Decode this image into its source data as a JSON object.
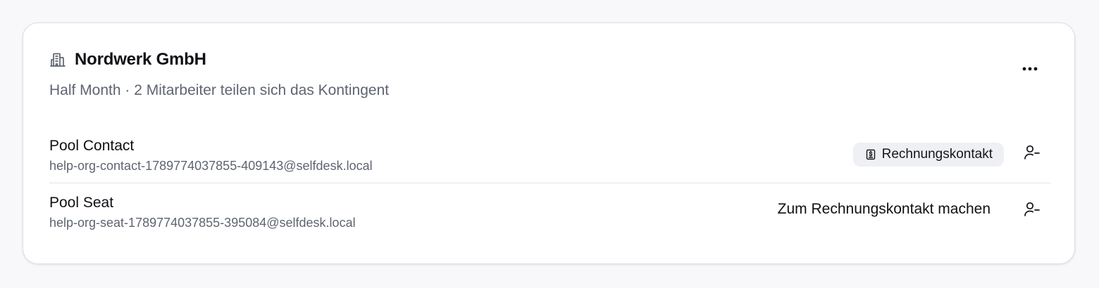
{
  "organization": {
    "name": "Nordwerk GmbH",
    "subtitle": "Half Month · 2 Mitarbeiter teilen sich das Kontingent",
    "icon": "building-icon",
    "more_icon": "more-horizontal-icon"
  },
  "members": [
    {
      "name": "Pool Contact",
      "email": "help-org-contact-1789774037855-409143@selfdesk.local",
      "badge_label": "Rechnungskontakt",
      "badge_icon": "receipt-dollar-icon",
      "remove_icon": "user-minus-icon"
    },
    {
      "name": "Pool Seat",
      "email": "help-org-seat-1789774037855-395084@selfdesk.local",
      "action_label": "Zum Rechnungskontakt machen",
      "remove_icon": "user-minus-icon"
    }
  ],
  "colors": {
    "page_background": "#f8f8fa",
    "card_background": "#ffffff",
    "badge_background": "#eef0f3",
    "muted_text": "#5e6470",
    "primary_text": "#0f1115"
  }
}
